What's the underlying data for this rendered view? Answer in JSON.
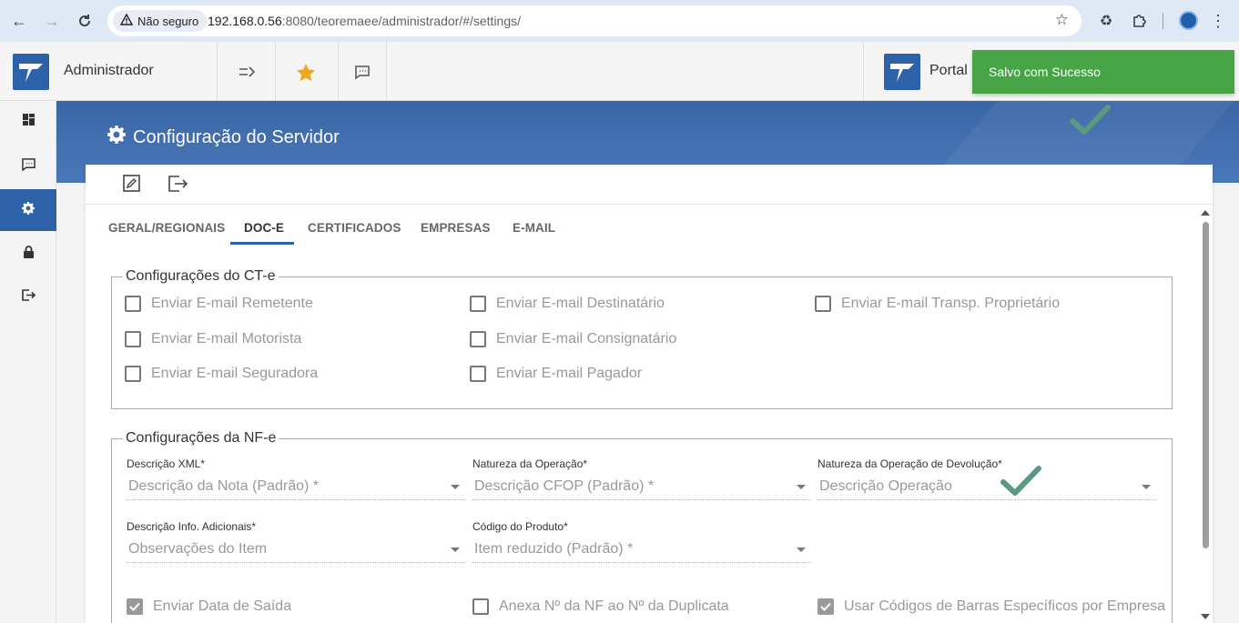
{
  "browser": {
    "security_label": "Não seguro",
    "url_host": "192.168.0.56",
    "url_rest": ":8080/teoremaee/administrador/#/settings/"
  },
  "header": {
    "app_title": "Administrador",
    "portal_label": "Portal"
  },
  "toast": {
    "message": "Salvo com Sucesso"
  },
  "page": {
    "title": "Configuração do Servidor"
  },
  "tabs": [
    {
      "label": "GERAL/REGIONAIS"
    },
    {
      "label": "DOC-E"
    },
    {
      "label": "CERTIFICADOS"
    },
    {
      "label": "EMPRESAS"
    },
    {
      "label": "E-MAIL"
    }
  ],
  "cte": {
    "legend": "Configurações do CT-e",
    "options": [
      {
        "label": "Enviar E-mail Remetente",
        "checked": false
      },
      {
        "label": "Enviar E-mail Destinatário",
        "checked": false
      },
      {
        "label": "Enviar E-mail Transp. Proprietário",
        "checked": false
      },
      {
        "label": "Enviar E-mail Motorista",
        "checked": false
      },
      {
        "label": "Enviar E-mail Consignatário",
        "checked": false
      },
      {
        "label": "Enviar E-mail Seguradora",
        "checked": false
      },
      {
        "label": "Enviar E-mail Pagador",
        "checked": false
      }
    ]
  },
  "nfe": {
    "legend": "Configurações da NF-e",
    "fields": [
      {
        "label": "Descrição XML*",
        "value": "Descrição da Nota (Padrão) *"
      },
      {
        "label": "Natureza da Operação*",
        "value": "Descrição CFOP (Padrão) *"
      },
      {
        "label": "Natureza da Operação de Devolução*",
        "value": "Descrição Operação"
      },
      {
        "label": "Descrição Info. Adicionais*",
        "value": "Observações do Item"
      },
      {
        "label": "Código do Produto*",
        "value": "Item reduzido (Padrão) *"
      }
    ],
    "options": [
      {
        "label": "Enviar Data de Saída",
        "checked": true
      },
      {
        "label": "Anexa Nº da NF ao Nº da Duplicata",
        "checked": false
      },
      {
        "label": "Usar Códigos de Barras Específicos por Empresa",
        "checked": true
      }
    ]
  },
  "colors": {
    "brand_blue": "#2d62a8",
    "toast_green": "#47a447",
    "check_green": "#5a9a7e"
  }
}
